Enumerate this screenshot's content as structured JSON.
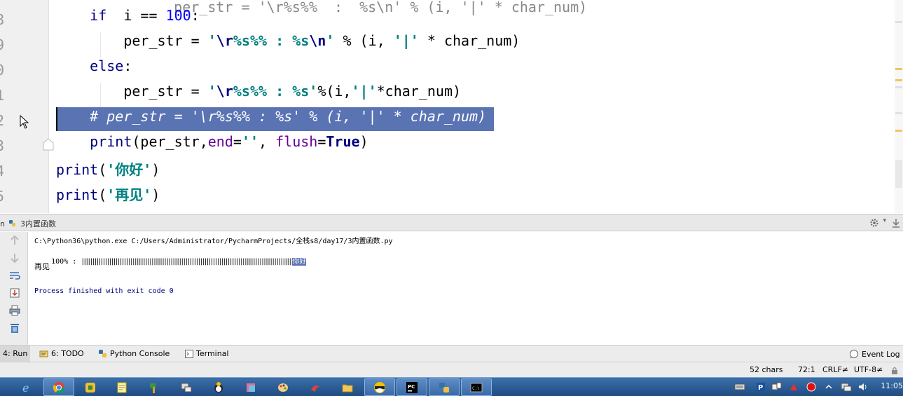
{
  "editor": {
    "line_numbers": [
      "8",
      "9",
      "0",
      "1",
      "2",
      "3",
      "4",
      "5"
    ],
    "partial_top_line": "per_str = '\\r%s%%  :  %s\\n' % (i, '|' * char_num)",
    "lines": [
      {
        "indent": "    ",
        "tokens": [
          [
            "kw2",
            "if"
          ],
          [
            "",
            "  i == "
          ],
          [
            "num",
            "100"
          ],
          [
            "",
            ":"
          ]
        ]
      },
      {
        "indent": "        ",
        "tokens": [
          [
            "",
            "per_str = "
          ],
          [
            "str",
            "'"
          ],
          [
            "esc",
            "\\r"
          ],
          [
            "str",
            "%s%% : %s"
          ],
          [
            "esc",
            "\\n"
          ],
          [
            "str",
            "'"
          ],
          [
            "",
            " % (i, "
          ],
          [
            "str",
            "'|'"
          ],
          [
            "",
            " * char_num)"
          ]
        ]
      },
      {
        "indent": "    ",
        "tokens": [
          [
            "kw2",
            "else"
          ],
          [
            "",
            ":"
          ]
        ]
      },
      {
        "indent": "        ",
        "tokens": [
          [
            "",
            "per_str = "
          ],
          [
            "str",
            "'"
          ],
          [
            "esc",
            "\\r"
          ],
          [
            "str",
            "%s%% : %s'"
          ],
          [
            "",
            "%(i,"
          ],
          [
            "str",
            "'|'"
          ],
          [
            "",
            "*char_num)"
          ]
        ]
      },
      {
        "indent": "    ",
        "tokens": [
          [
            "comment",
            "# per_str = '\\r%s%% : %s' % (i, '|' * char_num)"
          ]
        ]
      },
      {
        "indent": "    ",
        "tokens": [
          [
            "bi",
            "print"
          ],
          [
            "",
            "(per_str,"
          ],
          [
            "param",
            "end"
          ],
          [
            "",
            "="
          ],
          [
            "str",
            "''"
          ],
          [
            "",
            ", "
          ],
          [
            "param",
            "flush"
          ],
          [
            "",
            "="
          ],
          [
            "kw",
            "True"
          ],
          [
            "",
            ")"
          ]
        ]
      },
      {
        "indent": "",
        "tokens": [
          [
            "bi",
            "print"
          ],
          [
            "",
            "("
          ],
          [
            "str",
            "'你好'"
          ],
          [
            "",
            ")"
          ]
        ]
      },
      {
        "indent": "",
        "tokens": [
          [
            "bi",
            "print"
          ],
          [
            "",
            "("
          ],
          [
            "str",
            "'再见'"
          ],
          [
            "",
            ")"
          ]
        ]
      }
    ]
  },
  "run_panel": {
    "header_prefix": "n",
    "config_name": "3内置函数",
    "console": {
      "command": "C:\\Python36\\python.exe C:/Users/Administrator/PycharmProjects/全栈s8/day17/3内置函数.py",
      "progress_prefix": "100% : ",
      "progress_bars": "||||||||||||||||||||||||||||||||||||||||||||||||||||||||||||||||||||||||||||||||||||||||||||||||||||",
      "progress_tail": "你好",
      "line2": "再见",
      "exit_message": "Process finished with exit code 0"
    }
  },
  "tool_tabs": {
    "run": "4: Run",
    "todo": "6: TODO",
    "python_console": "Python Console",
    "terminal": "Terminal",
    "event_log": "Event Log"
  },
  "status_bar": {
    "chars": "52 chars",
    "position": "72:1",
    "line_sep": "CRLF≠",
    "encoding": "UTF-8≠"
  },
  "taskbar": {
    "clock": "11:05"
  },
  "colors": {
    "selection": "#5a73b3",
    "string": "#008080",
    "keyword": "#000080",
    "number": "#0000ff",
    "param": "#660099"
  }
}
